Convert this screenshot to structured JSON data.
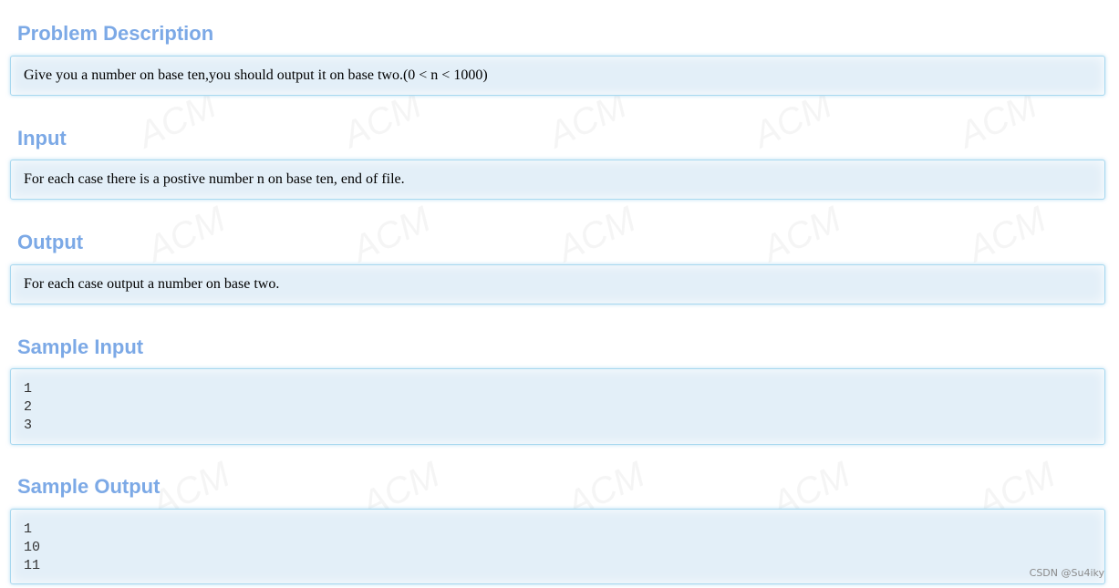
{
  "sections": {
    "description": {
      "title": "Problem Description",
      "text": "Give you a number on base ten,you should output it on base two.(0 < n < 1000)"
    },
    "input": {
      "title": "Input",
      "text": "For each case there is a postive number n on base ten, end of file."
    },
    "output": {
      "title": "Output",
      "text": "For each case output a number on base two."
    },
    "sample_input": {
      "title": "Sample Input",
      "lines": [
        "1",
        "2",
        "3"
      ]
    },
    "sample_output": {
      "title": "Sample Output",
      "lines": [
        "1",
        "10",
        "11"
      ]
    }
  },
  "watermark": {
    "text": "ACM"
  },
  "credit": "CSDN @Su4iky",
  "colors": {
    "heading": "#7ca9e6",
    "panel_bg": "#e3eff8",
    "panel_border": "#a7d8ef"
  }
}
